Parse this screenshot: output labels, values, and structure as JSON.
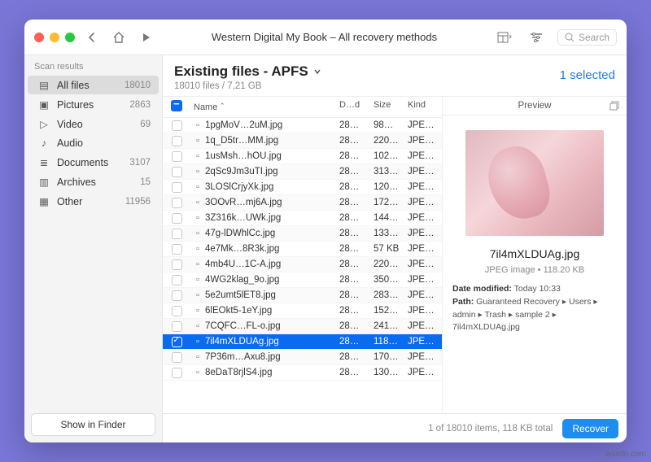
{
  "window_title": "Western Digital My Book – All recovery methods",
  "search_placeholder": "Search",
  "sidebar": {
    "header": "Scan results",
    "items": [
      {
        "icon": "▤",
        "label": "All files",
        "count": "18010"
      },
      {
        "icon": "▣",
        "label": "Pictures",
        "count": "2863"
      },
      {
        "icon": "▷",
        "label": "Video",
        "count": "69"
      },
      {
        "icon": "♪",
        "label": "Audio",
        "count": ""
      },
      {
        "icon": "≣",
        "label": "Documents",
        "count": "3107"
      },
      {
        "icon": "▥",
        "label": "Archives",
        "count": "15"
      },
      {
        "icon": "▦",
        "label": "Other",
        "count": "11956"
      }
    ],
    "show_in_finder": "Show in Finder"
  },
  "main": {
    "title": "Existing files - APFS",
    "subtitle": "18010 files / 7,21 GB",
    "selected_label": "1 selected",
    "columns": {
      "name": "Name",
      "date": "D…d",
      "size": "Size",
      "kind": "Kind"
    },
    "rows": [
      {
        "name": "1pgMoV…2uM.jpg",
        "date": "28…",
        "size": "98…",
        "kind": "JPE…",
        "sel": false
      },
      {
        "name": "1q_D5tr…MM.jpg",
        "date": "28…",
        "size": "220…",
        "kind": "JPE…",
        "sel": false
      },
      {
        "name": "1usMsh…hOU.jpg",
        "date": "28…",
        "size": "102…",
        "kind": "JPE…",
        "sel": false
      },
      {
        "name": "2qSc9Jm3uTI.jpg",
        "date": "28…",
        "size": "313…",
        "kind": "JPE…",
        "sel": false
      },
      {
        "name": "3LOSlCrjyXk.jpg",
        "date": "28…",
        "size": "120…",
        "kind": "JPE…",
        "sel": false
      },
      {
        "name": "3OOvR…mj6A.jpg",
        "date": "28…",
        "size": "172…",
        "kind": "JPE…",
        "sel": false
      },
      {
        "name": "3Z316k…UWk.jpg",
        "date": "28…",
        "size": "144…",
        "kind": "JPE…",
        "sel": false
      },
      {
        "name": "47g-lDWhlCc.jpg",
        "date": "28…",
        "size": "133…",
        "kind": "JPE…",
        "sel": false
      },
      {
        "name": "4e7Mk…8R3k.jpg",
        "date": "28…",
        "size": "57 KB",
        "kind": "JPE…",
        "sel": false
      },
      {
        "name": "4mb4U…1C-A.jpg",
        "date": "28…",
        "size": "220…",
        "kind": "JPE…",
        "sel": false
      },
      {
        "name": "4WG2klag_9o.jpg",
        "date": "28…",
        "size": "350…",
        "kind": "JPE…",
        "sel": false
      },
      {
        "name": "5e2umt5lET8.jpg",
        "date": "28…",
        "size": "283…",
        "kind": "JPE…",
        "sel": false
      },
      {
        "name": "6lEOkt5-1eY.jpg",
        "date": "28…",
        "size": "152…",
        "kind": "JPE…",
        "sel": false
      },
      {
        "name": "7CQFC…FL-o.jpg",
        "date": "28…",
        "size": "241…",
        "kind": "JPE…",
        "sel": false
      },
      {
        "name": "7il4mXLDUAg.jpg",
        "date": "28…",
        "size": "118…",
        "kind": "JPE…",
        "sel": true
      },
      {
        "name": "7P36m…Axu8.jpg",
        "date": "28…",
        "size": "170…",
        "kind": "JPE…",
        "sel": false
      },
      {
        "name": "8eDaT8rjlS4.jpg",
        "date": "28…",
        "size": "130…",
        "kind": "JPE…",
        "sel": false
      }
    ]
  },
  "preview": {
    "header": "Preview",
    "filename": "7il4mXLDUAg.jpg",
    "meta": "JPEG image • 118.20 KB",
    "date_modified_label": "Date modified:",
    "date_modified": "Today 10:33",
    "path_label": "Path:",
    "path": "Guaranteed Recovery ▸ Users ▸ admin ▸ Trash ▸ sample 2 ▸ 7il4mXLDUAg.jpg"
  },
  "footer": {
    "status": "1 of 18010 items, 118 KB total",
    "recover": "Recover"
  },
  "watermark": "wsxdn.com"
}
